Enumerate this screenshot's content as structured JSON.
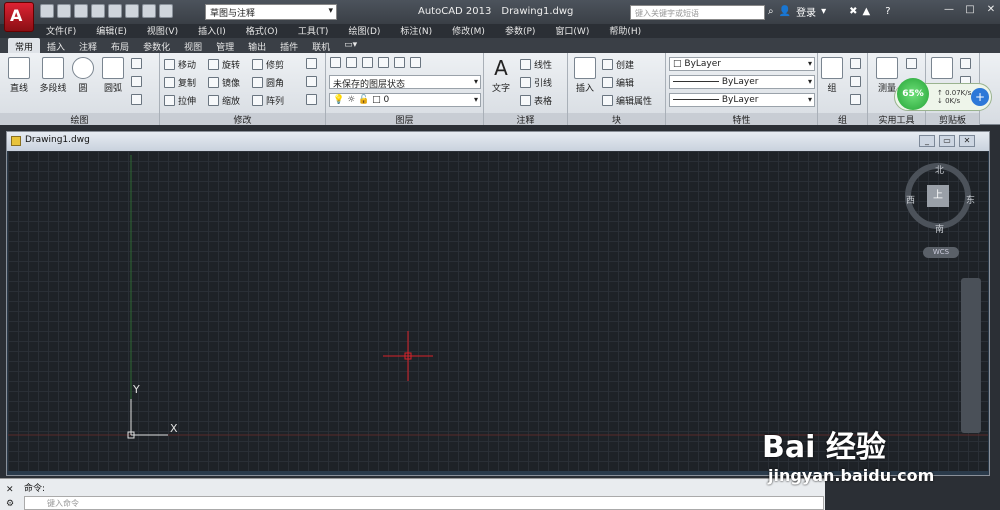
{
  "titlebar": {
    "workspace": "草图与注释",
    "app_name": "AutoCAD 2013",
    "doc_name": "Drawing1.dwg",
    "search_placeholder": "键入关键字或短语",
    "login": "登录"
  },
  "menubar": [
    "文件(F)",
    "编辑(E)",
    "视图(V)",
    "插入(I)",
    "格式(O)",
    "工具(T)",
    "绘图(D)",
    "标注(N)",
    "修改(M)",
    "参数(P)",
    "窗口(W)",
    "帮助(H)"
  ],
  "tabs": [
    "常用",
    "插入",
    "注释",
    "布局",
    "参数化",
    "视图",
    "管理",
    "输出",
    "插件",
    "联机"
  ],
  "ribbon": {
    "draw": {
      "title": "绘图",
      "line": "直线",
      "polyline": "多段线",
      "circle": "圆",
      "arc": "圆弧"
    },
    "modify": {
      "title": "修改",
      "move": "移动",
      "rotate": "旋转",
      "trim": "修剪",
      "copy": "复制",
      "mirror": "镜像",
      "fillet": "圆角",
      "stretch": "拉伸",
      "scale": "缩放",
      "array": "阵列"
    },
    "layers": {
      "title": "图层",
      "layer_state": "未保存的图层状态",
      "layer_current": "0"
    },
    "annotation": {
      "title": "注释",
      "text": "文字",
      "linear": "线性",
      "leader": "引线",
      "table": "表格"
    },
    "block": {
      "title": "块",
      "insert": "插入",
      "create": "创建",
      "edit": "编辑",
      "edit_attr": "编辑属性"
    },
    "properties": {
      "title": "特性",
      "color": "ByLayer",
      "linetype": "ByLayer",
      "lineweight": "ByLayer"
    },
    "groups": {
      "title": "组",
      "group": "组"
    },
    "utilities": {
      "title": "实用工具",
      "measure": "测量"
    },
    "clipboard": {
      "title": "剪贴板"
    }
  },
  "document": {
    "tab": "Drawing1.dwg"
  },
  "viewcube": {
    "north": "北",
    "south": "南",
    "east": "东",
    "west": "西",
    "top": "上",
    "wcs": "WCS"
  },
  "ucs": {
    "x": "X",
    "y": "Y"
  },
  "speed_widget": {
    "percent": "65%",
    "up": "0.07K/s",
    "down": "0K/s"
  },
  "command": {
    "label": "命令:",
    "placeholder": "键入命令"
  },
  "watermark": {
    "brand": "Bai 经验",
    "url": "jingyan.baidu.com"
  }
}
